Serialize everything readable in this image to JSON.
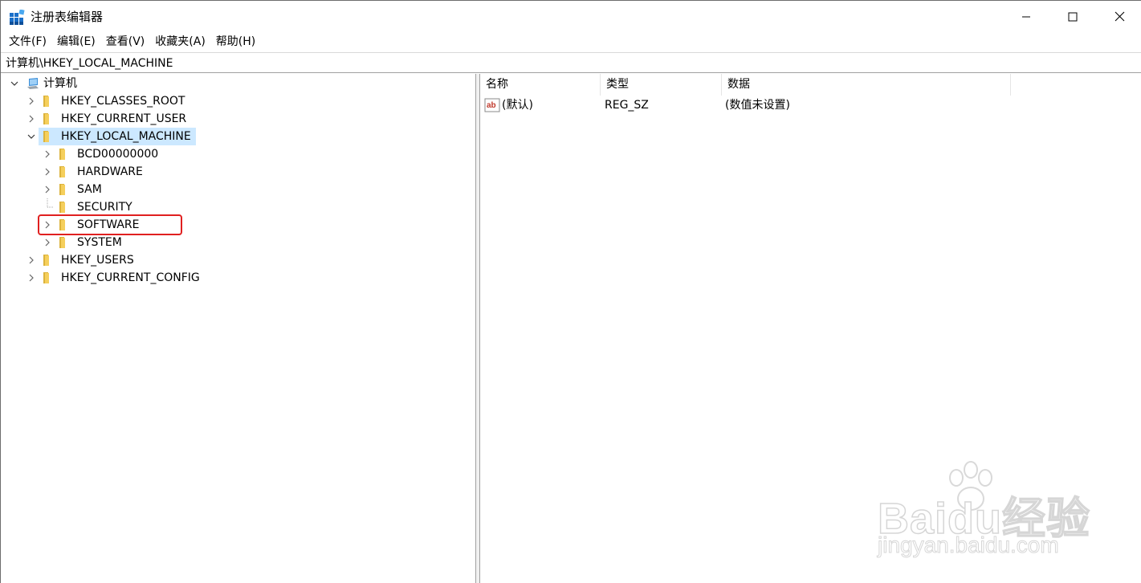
{
  "window": {
    "title": "注册表编辑器",
    "controls": [
      "minimize",
      "maximize",
      "close"
    ]
  },
  "menu": [
    {
      "label": "文件(F)"
    },
    {
      "label": "编辑(E)"
    },
    {
      "label": "查看(V)"
    },
    {
      "label": "收藏夹(A)"
    },
    {
      "label": "帮助(H)"
    }
  ],
  "address": "计算机\\HKEY_LOCAL_MACHINE",
  "tree": {
    "root": {
      "label": "计算机",
      "icon": "computer-icon",
      "expanded": true
    },
    "items": [
      {
        "label": "HKEY_CLASSES_ROOT",
        "level": 1,
        "expander": "collapsed"
      },
      {
        "label": "HKEY_CURRENT_USER",
        "level": 1,
        "expander": "collapsed"
      },
      {
        "label": "HKEY_LOCAL_MACHINE",
        "level": 1,
        "expander": "expanded",
        "selected": true
      },
      {
        "label": "BCD00000000",
        "level": 2,
        "expander": "collapsed"
      },
      {
        "label": "HARDWARE",
        "level": 2,
        "expander": "collapsed"
      },
      {
        "label": "SAM",
        "level": 2,
        "expander": "collapsed"
      },
      {
        "label": "SECURITY",
        "level": 2,
        "expander": "none"
      },
      {
        "label": "SOFTWARE",
        "level": 2,
        "expander": "collapsed",
        "highlighted": true
      },
      {
        "label": "SYSTEM",
        "level": 2,
        "expander": "collapsed"
      },
      {
        "label": "HKEY_USERS",
        "level": 1,
        "expander": "collapsed"
      },
      {
        "label": "HKEY_CURRENT_CONFIG",
        "level": 1,
        "expander": "collapsed"
      }
    ]
  },
  "list": {
    "columns": {
      "name": "名称",
      "type": "类型",
      "data": "数据"
    },
    "rows": [
      {
        "name": "(默认)",
        "type": "REG_SZ",
        "data": "(数值未设置)",
        "icon": "reg-sz-icon"
      }
    ]
  },
  "watermark": {
    "brand": "Baidu经验",
    "url": "jingyan.baidu.com"
  },
  "colors": {
    "selection": "#cce8ff",
    "highlight_box": "#e02020",
    "folder": "#f0c64a"
  }
}
